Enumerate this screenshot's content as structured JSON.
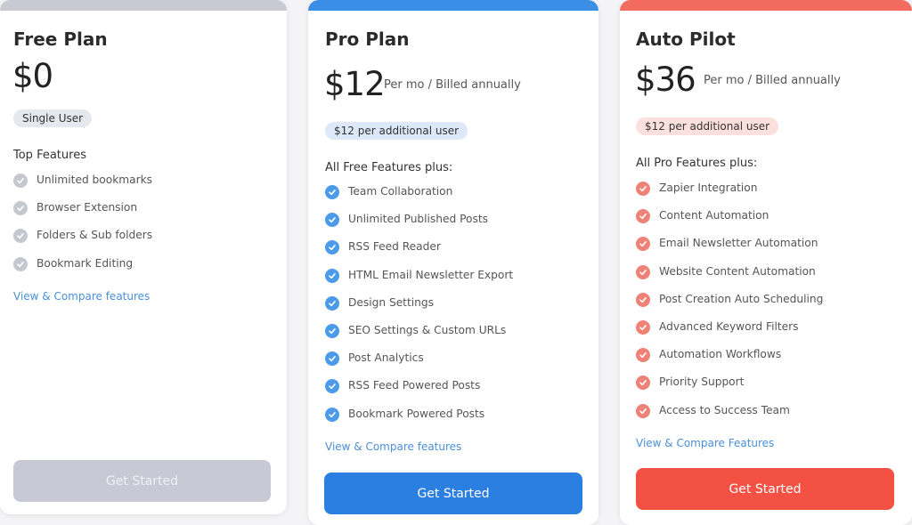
{
  "colors": {
    "free_accent": "#c8c9d3",
    "pro_accent": "#3b8ee6",
    "auto_accent": "#f26b5e",
    "link": "#4a8fd8"
  },
  "plans": {
    "free": {
      "name": "Free Plan",
      "price": "$0",
      "pill": "Single User",
      "features_title": "Top Features",
      "features": [
        "Unlimited bookmarks",
        "Browser Extension",
        "Folders & Sub folders",
        "Bookmark Editing"
      ],
      "link": "View & Compare features",
      "button": "Get Started"
    },
    "pro": {
      "name": "Pro Plan",
      "price": "$12",
      "billing": "Per mo / Billed annually",
      "pill": "$12 per additional user",
      "features_title": "All Free Features plus:",
      "features": [
        "Team Collaboration",
        "Unlimited Published Posts",
        "RSS Feed Reader",
        "HTML Email Newsletter Export",
        "Design Settings",
        "SEO Settings & Custom URLs",
        "Post Analytics",
        "RSS Feed Powered Posts",
        "Bookmark Powered Posts"
      ],
      "link": "View & Compare features",
      "button": "Get Started"
    },
    "auto": {
      "name": "Auto Pilot",
      "price": "$36",
      "billing": "Per mo / Billed annually",
      "pill": "$12 per additional user",
      "features_title": "All Pro Features plus:",
      "features": [
        "Zapier Integration",
        "Content Automation",
        "Email Newsletter Automation",
        "Website Content Automation",
        "Post Creation Auto Scheduling",
        "Advanced Keyword Filters",
        "Automation Workflows",
        "Priority Support",
        "Access to Success Team"
      ],
      "link": "View & Compare Features",
      "button": "Get Started"
    }
  }
}
